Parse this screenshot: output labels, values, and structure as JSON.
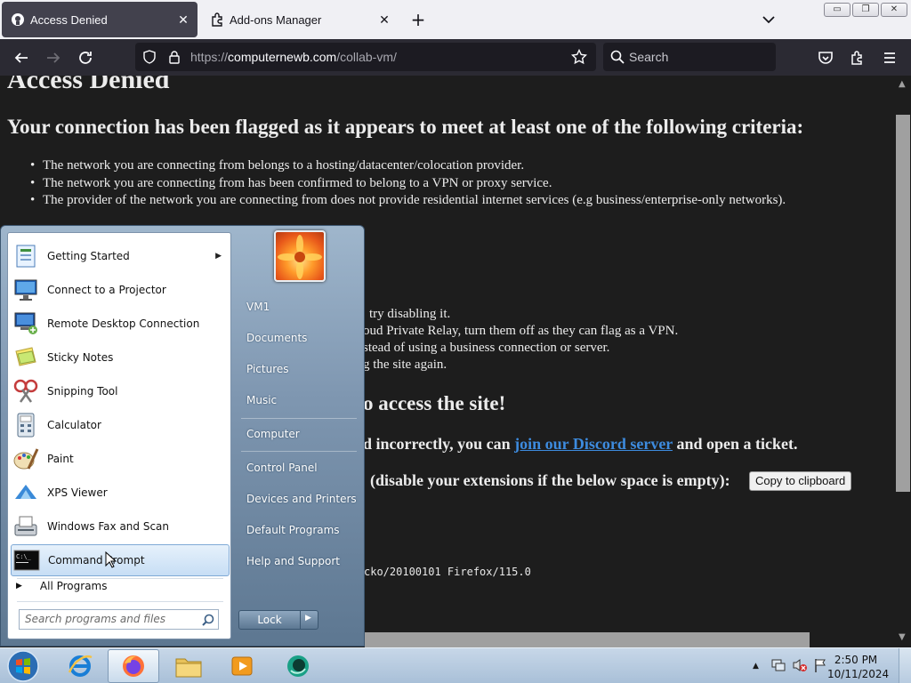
{
  "tabs": [
    {
      "label": "Access Denied",
      "active": true
    },
    {
      "label": "Add-ons Manager",
      "active": false
    }
  ],
  "nav": {
    "url_prefix": "https://",
    "url_host": "computernewb.com",
    "url_path": "/collab-vm/",
    "search_placeholder": "Search"
  },
  "page": {
    "title": "Access Denied",
    "subtitle": "Your connection has been flagged as it appears to meet at least one of the following criteria:",
    "criteria": [
      "The network you are connecting from belongs to a hosting/datacenter/colocation provider.",
      "The network you are connecting from has been confirmed to belong to a VPN or proxy service.",
      "The provider of the network you are connecting from does not provide residential internet services (e.g business/enterprise-only networks)."
    ],
    "steps_partial": [
      "try disabling it.",
      "oud Private Relay, turn them off as they can flag as a VPN.",
      "stead of using a business connection or server.",
      "g the site again."
    ],
    "access_partial": "o access the site!",
    "incorrect_partial": "d incorrectly, you can ",
    "discord_link": "join our Discord server",
    "incorrect_suffix": " and open a ticket.",
    "extensions_partial": "(disable your extensions if the below space is empty):",
    "copy_button": "Copy to clipboard",
    "useragent_partial": "cko/20100101 Firefox/115.0"
  },
  "startmenu": {
    "programs": [
      {
        "label": "Getting Started",
        "icon": "getting-started-icon",
        "submenu": true
      },
      {
        "label": "Connect to a Projector",
        "icon": "projector-icon"
      },
      {
        "label": "Remote Desktop Connection",
        "icon": "remote-desktop-icon"
      },
      {
        "label": "Sticky Notes",
        "icon": "sticky-notes-icon"
      },
      {
        "label": "Snipping Tool",
        "icon": "snipping-tool-icon"
      },
      {
        "label": "Calculator",
        "icon": "calculator-icon"
      },
      {
        "label": "Paint",
        "icon": "paint-icon"
      },
      {
        "label": "XPS Viewer",
        "icon": "xps-viewer-icon"
      },
      {
        "label": "Windows Fax and Scan",
        "icon": "fax-scan-icon"
      },
      {
        "label": "Command Prompt",
        "icon": "command-prompt-icon",
        "selected": true
      }
    ],
    "all_programs": "All Programs",
    "search_placeholder": "Search programs and files",
    "right_links": [
      "VM1",
      "Documents",
      "Pictures",
      "Music",
      "Computer",
      "Control Panel",
      "Devices and Printers",
      "Default Programs",
      "Help and Support"
    ],
    "lock_label": "Lock"
  },
  "taskbar": {
    "time": "2:50 PM",
    "date": "10/11/2024"
  },
  "colors": {
    "accent_link": "#3d8bde",
    "page_bg": "#1d1d1d",
    "toolbar": "#2b2a33"
  }
}
